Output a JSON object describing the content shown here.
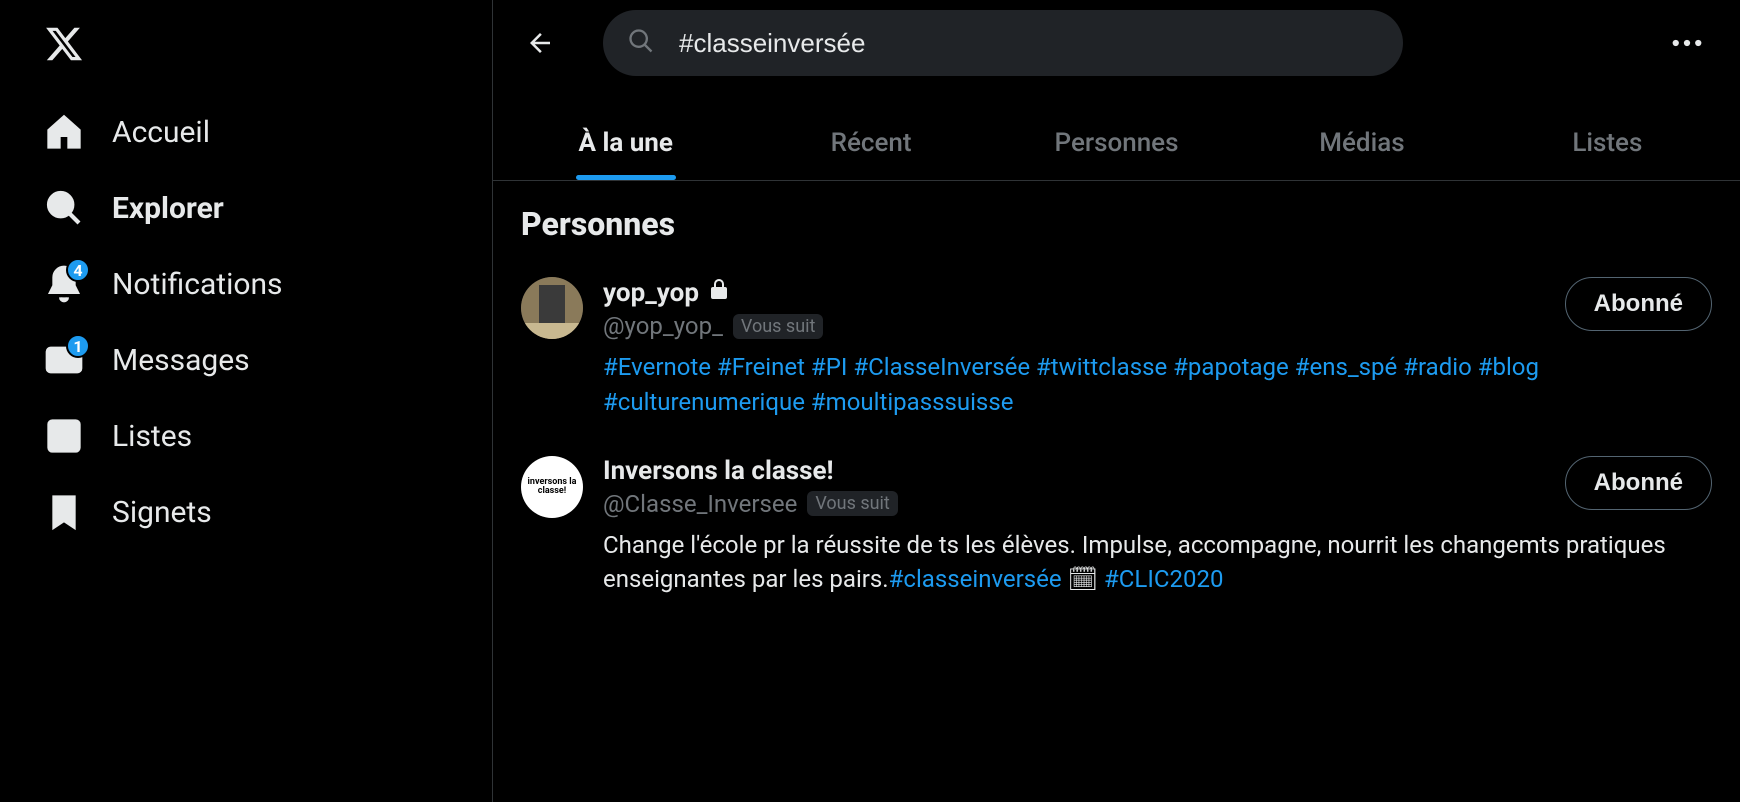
{
  "sidebar": {
    "items": [
      {
        "label": "Accueil",
        "badge": null
      },
      {
        "label": "Explorer",
        "badge": null
      },
      {
        "label": "Notifications",
        "badge": "4"
      },
      {
        "label": "Messages",
        "badge": "1"
      },
      {
        "label": "Listes",
        "badge": null
      },
      {
        "label": "Signets",
        "badge": null
      }
    ]
  },
  "search": {
    "query": "#classeinversée"
  },
  "tabs": [
    {
      "label": "À la une",
      "active": true
    },
    {
      "label": "Récent",
      "active": false
    },
    {
      "label": "Personnes",
      "active": false
    },
    {
      "label": "Médias",
      "active": false
    },
    {
      "label": "Listes",
      "active": false
    }
  ],
  "section_title": "Personnes",
  "people": [
    {
      "display_name": "yop_yop",
      "locked": true,
      "handle": "@yop_yop_",
      "follows_you": "Vous suit",
      "follow_state": "Abonné",
      "bio_tags": [
        "#Evernote",
        "#Freinet",
        "#PI",
        "#ClasseInversée",
        "#twittclasse",
        "#papotage",
        "#ens_spé",
        "#radio",
        "#blog",
        "#culturenumerique",
        "#moultipasssuisse"
      ]
    },
    {
      "display_name": "Inversons la classe!",
      "locked": false,
      "handle": "@Classe_Inversee",
      "follows_you": "Vous suit",
      "follow_state": "Abonné",
      "bio_text_before": "Change l'école pr la réussite de ts les élèves. Impulse, accompagne, nourrit les changemts pratiques enseignantes par les pairs.",
      "bio_tag1": "#classeinversée",
      "bio_emoji": "🗓",
      "bio_tag2": "#CLIC2020",
      "avatar_text": "inversons la classe!"
    }
  ]
}
